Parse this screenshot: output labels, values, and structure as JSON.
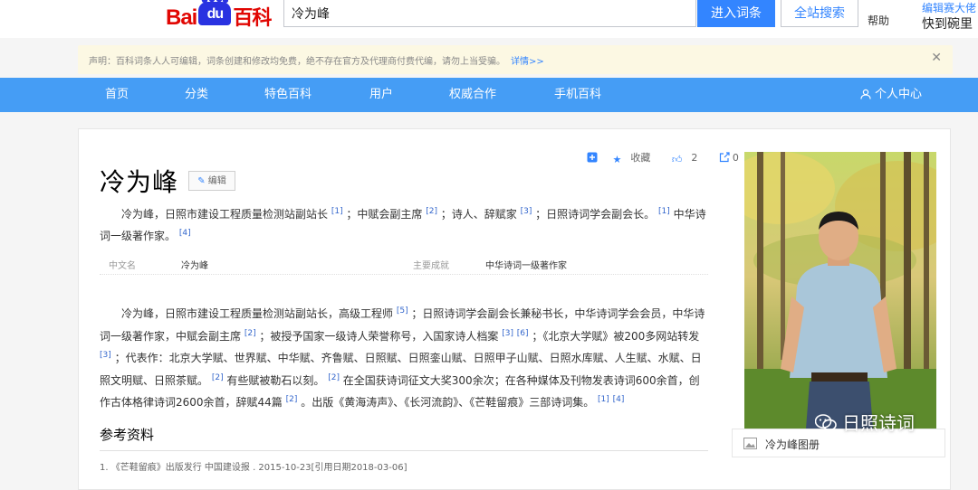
{
  "header": {
    "logo_text_1": "Bai",
    "logo_text_2": "du",
    "logo_text_3": "百科",
    "search_value": "冷为峰",
    "enter_button": "进入词条",
    "search_all_button": "全站搜索",
    "help_link": "帮助",
    "promo_line1": "编辑赛大佬",
    "promo_line2": "快到碗里"
  },
  "notice": {
    "text": "声明：百科词条人人可编辑，词条创建和修改均免费，绝不存在官方及代理商付费代编，请勿上当受骗。",
    "link": "详情>>"
  },
  "nav": {
    "items": [
      "首页",
      "分类",
      "特色百科",
      "用户",
      "权威合作",
      "手机百科"
    ],
    "user_center": "个人中心"
  },
  "article": {
    "title": "冷为峰",
    "edit_label": "编辑",
    "tools": {
      "collect": "收藏",
      "like_count": "2",
      "share_count": "0"
    },
    "summary_parts": [
      "冷为峰，日照市建设工程质量检测站副站长 ",
      "[1]",
      " ；中赋会副主席 ",
      "[2]",
      " ；诗人、辞赋家 ",
      "[3]",
      " ；日照诗词学会副会长。 ",
      "[1]",
      " 中华诗词一级著作家。 ",
      "[4]"
    ],
    "basic_info": {
      "name_key": "中文名",
      "name_value": "冷为峰",
      "achievement_key": "主要成就",
      "achievement_value": "中华诗词一级著作家"
    },
    "body_parts": [
      "冷为峰，日照市建设工程质量检测站副站长，高级工程师 ",
      "[5]",
      " ；日照诗词学会副会长兼秘书长，中华诗词学会会员，中华诗词一级著作家，中赋会副主席 ",
      "[2]",
      " ；被授予国家一级诗人荣誉称号，入国家诗人档案 ",
      "[3]",
      " ",
      "[6]",
      " ；《北京大学赋》被200多网站转发 ",
      "[3]",
      " ；代表作：北京大学赋、世界赋、中华赋、齐鲁赋、日照赋、日照銮山赋、日照甲子山赋、日照水库赋、人生赋、水赋、日照文明赋、日照茶赋。 ",
      "[2]",
      " 有些赋被勒石以刻。 ",
      "[2]",
      " 在全国获诗词征文大奖300余次；在各种媒体及刊物发表诗词600余首，创作古体格律诗词2600余首，辞赋44篇 ",
      "[2]",
      " 。出版《黄海涛声》、《长河流韵》、《芒鞋留痕》三部诗词集。 ",
      "[1]",
      " ",
      "[4]"
    ],
    "references_title": "参考资料",
    "reference_1": "1.  《芒鞋留痕》出版发行    中国建设报 . 2015-10-23[引用日期2018-03-06]"
  },
  "sidebar": {
    "album_label": "冷为峰图册"
  },
  "watermark": {
    "text": "日照诗词"
  },
  "colors": {
    "nav_blue": "#459df5",
    "button_blue": "#3385ff",
    "notice_bg": "#fcf8e3",
    "baidu_red": "#e10602",
    "ref_link": "#3366cc"
  }
}
